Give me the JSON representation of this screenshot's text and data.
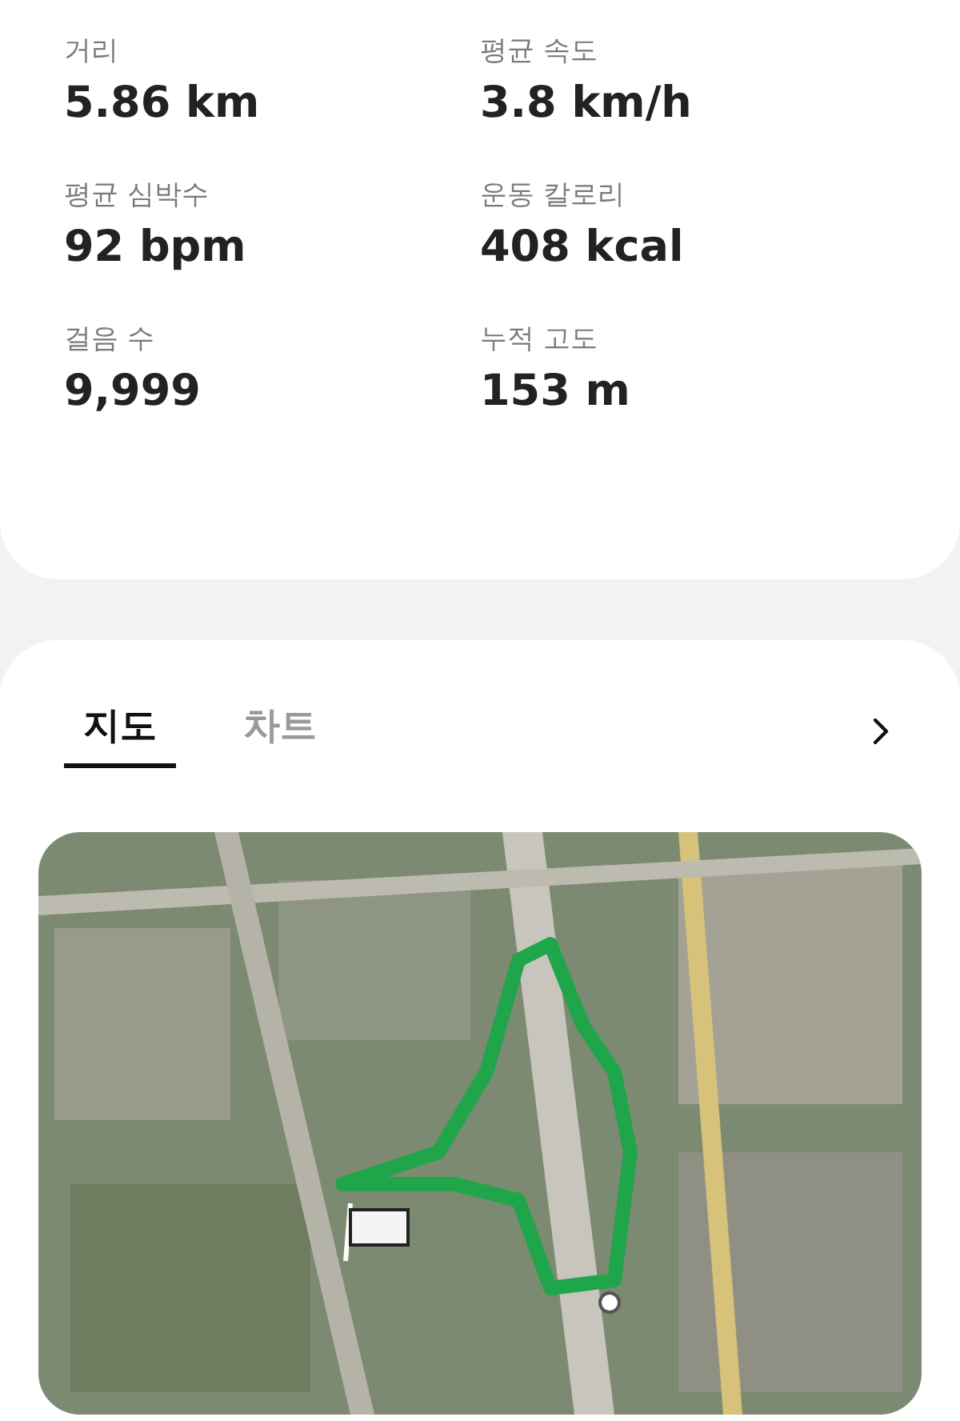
{
  "stats": [
    {
      "label": "거리",
      "value": "5.86 km"
    },
    {
      "label": "평균 속도",
      "value": "3.8 km/h"
    },
    {
      "label": "평균 심박수",
      "value": "92 bpm"
    },
    {
      "label": "운동 칼로리",
      "value": "408 kcal"
    },
    {
      "label": "걸음 수",
      "value": "9,999"
    },
    {
      "label": "누적 고도",
      "value": "153 m"
    }
  ],
  "tabs": [
    {
      "label": "지도",
      "selected": true
    },
    {
      "label": "차트",
      "selected": false
    }
  ]
}
